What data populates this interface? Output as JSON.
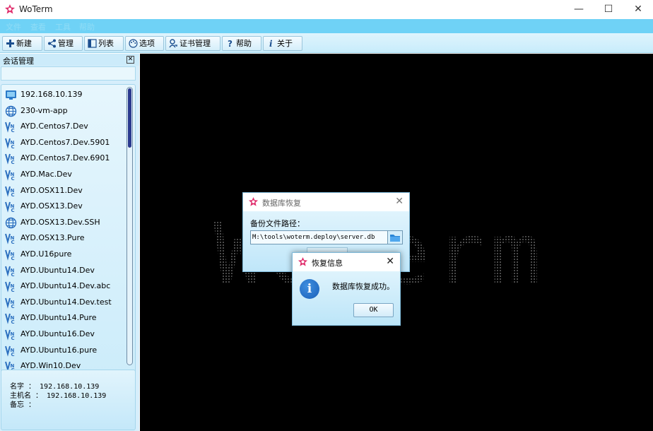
{
  "window": {
    "title": "WoTerm",
    "minimize_glyph": "—",
    "maximize_glyph": "☐",
    "close_glyph": "✕"
  },
  "menu": [
    "文件",
    "查看",
    "工具",
    "帮助"
  ],
  "toolbar": [
    {
      "label": "新建",
      "icon": "plus-icon"
    },
    {
      "label": "管理",
      "icon": "share-nodes-icon"
    },
    {
      "label": "列表",
      "icon": "list-panel-icon"
    },
    {
      "label": "选项",
      "icon": "palette-icon"
    },
    {
      "label": "证书管理",
      "icon": "key-user-icon"
    },
    {
      "label": "帮助",
      "icon": "question-icon"
    },
    {
      "label": "关于",
      "icon": "info-italic-icon"
    }
  ],
  "sidebar": {
    "title": "会话管理",
    "close_glyph": "✕",
    "search_value": "",
    "sessions": [
      {
        "label": "192.168.10.139",
        "icon": "rdp-monitor-icon"
      },
      {
        "label": "230-vm-app",
        "icon": "globe-icon"
      },
      {
        "label": "AYD.Centos7.Dev",
        "icon": "vnc-icon"
      },
      {
        "label": "AYD.Centos7.Dev.5901",
        "icon": "vnc-icon"
      },
      {
        "label": "AYD.Centos7.Dev.6901",
        "icon": "vnc-icon"
      },
      {
        "label": "AYD.Mac.Dev",
        "icon": "vnc-icon"
      },
      {
        "label": "AYD.OSX11.Dev",
        "icon": "vnc-icon"
      },
      {
        "label": "AYD.OSX13.Dev",
        "icon": "vnc-icon"
      },
      {
        "label": "AYD.OSX13.Dev.SSH",
        "icon": "globe-icon"
      },
      {
        "label": "AYD.OSX13.Pure",
        "icon": "vnc-icon"
      },
      {
        "label": "AYD.U16pure",
        "icon": "vnc-icon"
      },
      {
        "label": "AYD.Ubuntu14.Dev",
        "icon": "vnc-icon"
      },
      {
        "label": "AYD.Ubuntu14.Dev.abc",
        "icon": "vnc-icon"
      },
      {
        "label": "AYD.Ubuntu14.Dev.test",
        "icon": "vnc-icon"
      },
      {
        "label": "AYD.Ubuntu14.Pure",
        "icon": "vnc-icon"
      },
      {
        "label": "AYD.Ubuntu16.Dev",
        "icon": "vnc-icon"
      },
      {
        "label": "AYD.Ubuntu16.pure",
        "icon": "vnc-icon"
      },
      {
        "label": "AYD.Win10.Dev",
        "icon": "vnc-icon"
      }
    ],
    "info": {
      "name_line": "名字 ： 192.168.10.139",
      "host_line": "主机名 ： 192.168.10.139",
      "note_line": "备忘 ："
    }
  },
  "terminal": {
    "logo_text": "WoTerm"
  },
  "restore_dialog": {
    "title": "数据库恢复",
    "close_glyph": "✕",
    "path_label": "备份文件路径：",
    "path_value": "M:\\tools\\woterm.deploy\\server.db"
  },
  "info_dialog": {
    "title": "恢复信息",
    "close_glyph": "✕",
    "icon_glyph": "i",
    "message": "数据库恢复成功。",
    "ok_label": "OK"
  },
  "colors": {
    "accent": "#6fd2f6",
    "brand_logo": "#e0306e",
    "terminal_bg": "#000000"
  }
}
